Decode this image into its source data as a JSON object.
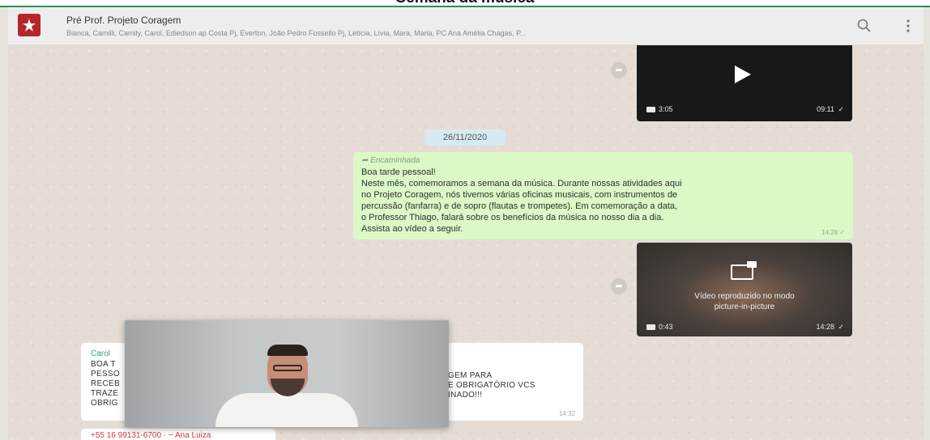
{
  "banner": {
    "title": "Semana da música"
  },
  "header": {
    "group_name": "Pré Prof. Projeto Coragem",
    "members": "Bianca, Camilli, Camily, Carol, Ediedson ap Costa Pj, Everton, João Pedro Fossello Pj, Letícia, Lívia, Mara, Maria, PC Ana Amélia Chagas, P...",
    "search_icon": "search-icon",
    "menu_icon": "menu-dots-icon"
  },
  "chat": {
    "video1": {
      "duration": "3:05",
      "time": "09:11"
    },
    "date_chip": "26/11/2020",
    "forwarded_message": {
      "forwarded_label": "Encaminhada",
      "lines": [
        "Boa tarde pessoal!",
        "Neste mês, comemoramos a semana da música. Durante nossas atividades aqui",
        "no Projeto Coragem, nós tivemos várias oficinas musicais, com instrumentos de",
        "percussão (fanfarra) e de sopro (flautas e trompetes). Em comemoração a data,",
        "o Professor Thiago, falará sobre os benefícios da música no nosso dia a dia.",
        "Assista ao vídeo a seguir."
      ],
      "time": "14:28"
    },
    "video2": {
      "line1": "Vídeo reproduzido no modo",
      "line2": "picture-in-picture",
      "duration": "0:43",
      "time": "14:28"
    },
    "incoming_message": {
      "sender": "Carol",
      "left_lines": [
        "BOA T",
        "PESSO",
        "RECEB",
        "TRAZE",
        "OBRIG"
      ],
      "right_lines": [
        "GEM PARA",
        "E OBRIGATÓRIO VCS",
        "INADO!!!"
      ],
      "time": "14:32"
    },
    "incoming_message2": {
      "sender": "+55 16 99131-6700 · ~ Ana Luiza"
    }
  }
}
